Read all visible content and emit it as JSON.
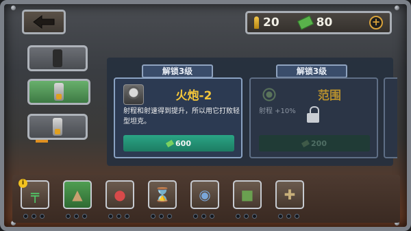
{
  "resources": {
    "ammo": "20",
    "cash": "80"
  },
  "cards": [
    {
      "tag": "解锁3级",
      "title": "火炮-2",
      "desc": "射程和射速得到提升，所以用它打败轻型坦克。",
      "price": "600",
      "locked": false
    },
    {
      "tag": "解锁3级",
      "title": "范围",
      "desc": "射程 +10%",
      "price": "200",
      "locked": true
    }
  ],
  "info_badge": "i",
  "colors": {
    "accent_green": "#1d7c63",
    "title_gold": "#f4c63a"
  },
  "icons": [
    "back-arrow-icon",
    "bullet-icon",
    "cash-icon",
    "plus-icon",
    "tower-icon",
    "lock-icon",
    "mg-turret-icon",
    "mortar-icon",
    "rocket-launcher-icon",
    "hourglass-icon",
    "radar-icon",
    "jerrycan-icon",
    "medkit-icon"
  ]
}
